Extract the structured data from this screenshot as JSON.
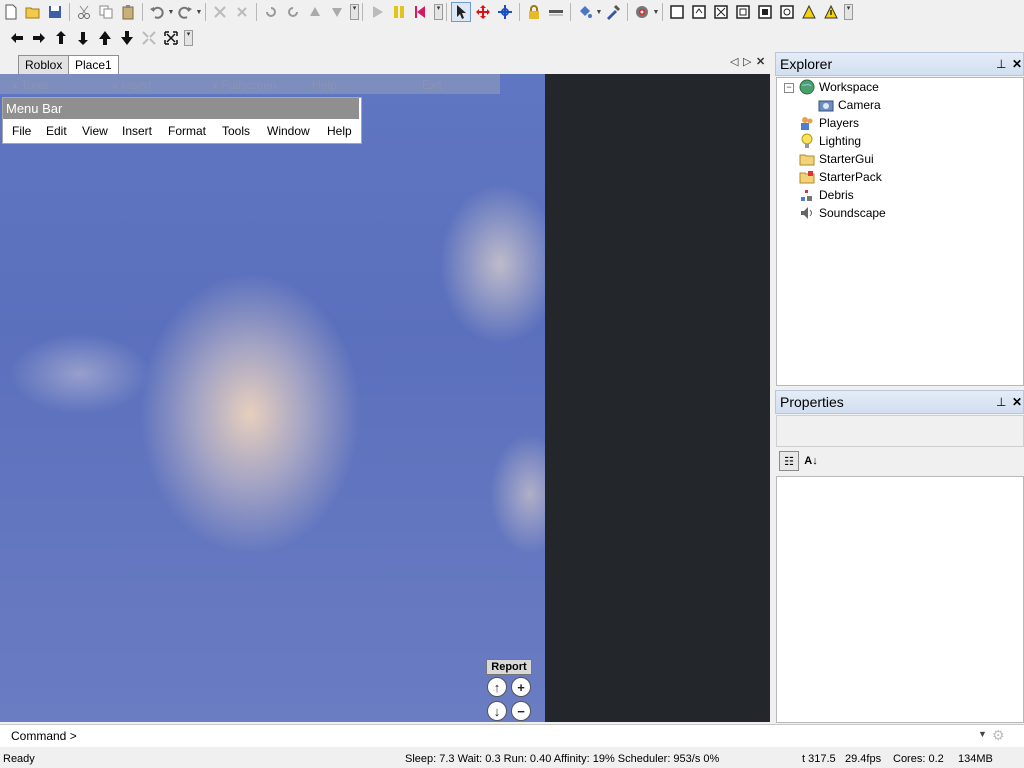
{
  "tabs": {
    "roblox": "Roblox",
    "place1": "Place1"
  },
  "overlay": {
    "tools": "x Tools",
    "insert": "x Insert",
    "fullscreen": "x Fullscreen",
    "help": "Help...",
    "exit": "Exit"
  },
  "menu_window": {
    "title": "Menu Bar",
    "items": [
      "File",
      "Edit",
      "View",
      "Insert",
      "Format",
      "Tools",
      "Window",
      "Help"
    ]
  },
  "nav": {
    "report": "Report"
  },
  "explorer": {
    "title": "Explorer",
    "items": [
      "Workspace",
      "Camera",
      "Players",
      "Lighting",
      "StarterGui",
      "StarterPack",
      "Debris",
      "Soundscape"
    ]
  },
  "properties": {
    "title": "Properties"
  },
  "command": {
    "label": "Command >",
    "value": ""
  },
  "status": {
    "ready": "Ready",
    "stats": "Sleep: 7.3 Wait: 0.3 Run: 0.40 Affinity: 19% Scheduler: 953/s 0%",
    "time": "t 317.5",
    "fps": "29.4fps",
    "cores": "Cores: 0.2",
    "memory": "134MB"
  },
  "colors": {
    "panel_title": "#d8e4f2",
    "viewport_sky": "#5f76c2",
    "viewport_dark": "#23272b"
  }
}
